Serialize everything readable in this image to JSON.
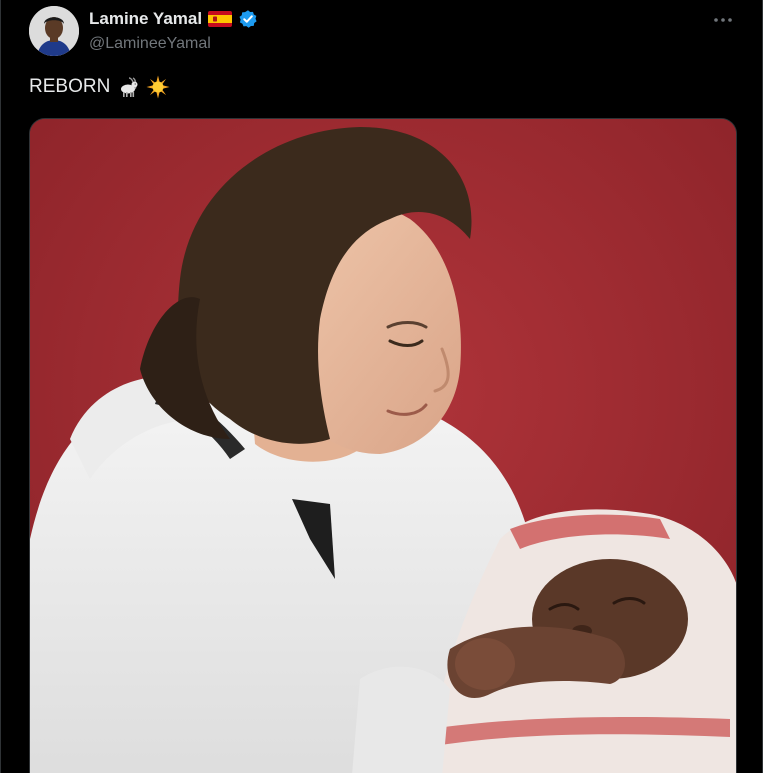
{
  "tweet": {
    "author": {
      "display_name": "Lamine Yamal",
      "handle": "@LamineeYamal",
      "flag_icon": "spain-flag-icon",
      "verified_icon": "verified-badge-icon",
      "verified_color": "#1d9bf0"
    },
    "more_icon": "more-dots-icon",
    "text": "REBORN",
    "emojis": [
      "goat-emoji-icon",
      "sun-emoji-icon"
    ],
    "media": {
      "icon": "photo"
    }
  },
  "colors": {
    "background": "#000000",
    "text_primary": "#e7e9ea",
    "text_secondary": "#71767b",
    "border": "#2f3336",
    "photo_backdrop": "#9e2a30"
  }
}
